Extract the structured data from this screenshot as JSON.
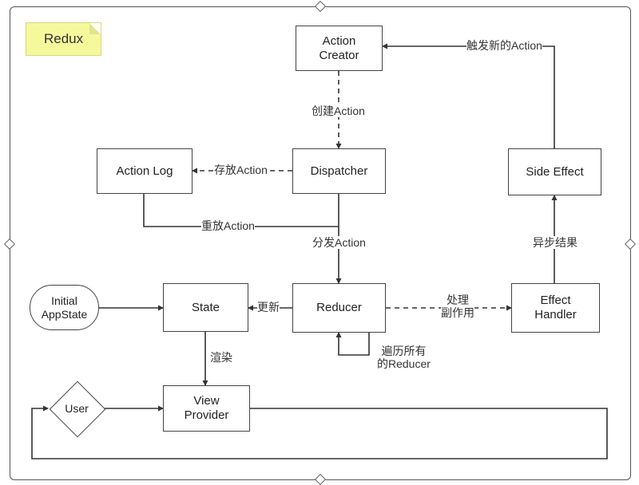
{
  "title": "Redux",
  "nodes": {
    "actionCreator": "Action\nCreator",
    "actionLog": "Action Log",
    "dispatcher": "Dispatcher",
    "sideEffect": "Side Effect",
    "initialAppState": "Initial\nAppState",
    "state": "State",
    "reducer": "Reducer",
    "effectHandler": "Effect\nHandler",
    "user": "User",
    "viewProvider": "View\nProvider"
  },
  "edges": {
    "triggerNewAction": "触发新的Action",
    "createAction": "创建Action",
    "storeAction": "存放Action",
    "replayAction": "重放Action",
    "dispatchAction": "分发Action",
    "asyncResult": "异步结果",
    "update": "更新",
    "handleSideEffect": "处理\n副作用",
    "render": "渲染",
    "iterateReducers": "遍历所有\n的Reducer"
  }
}
